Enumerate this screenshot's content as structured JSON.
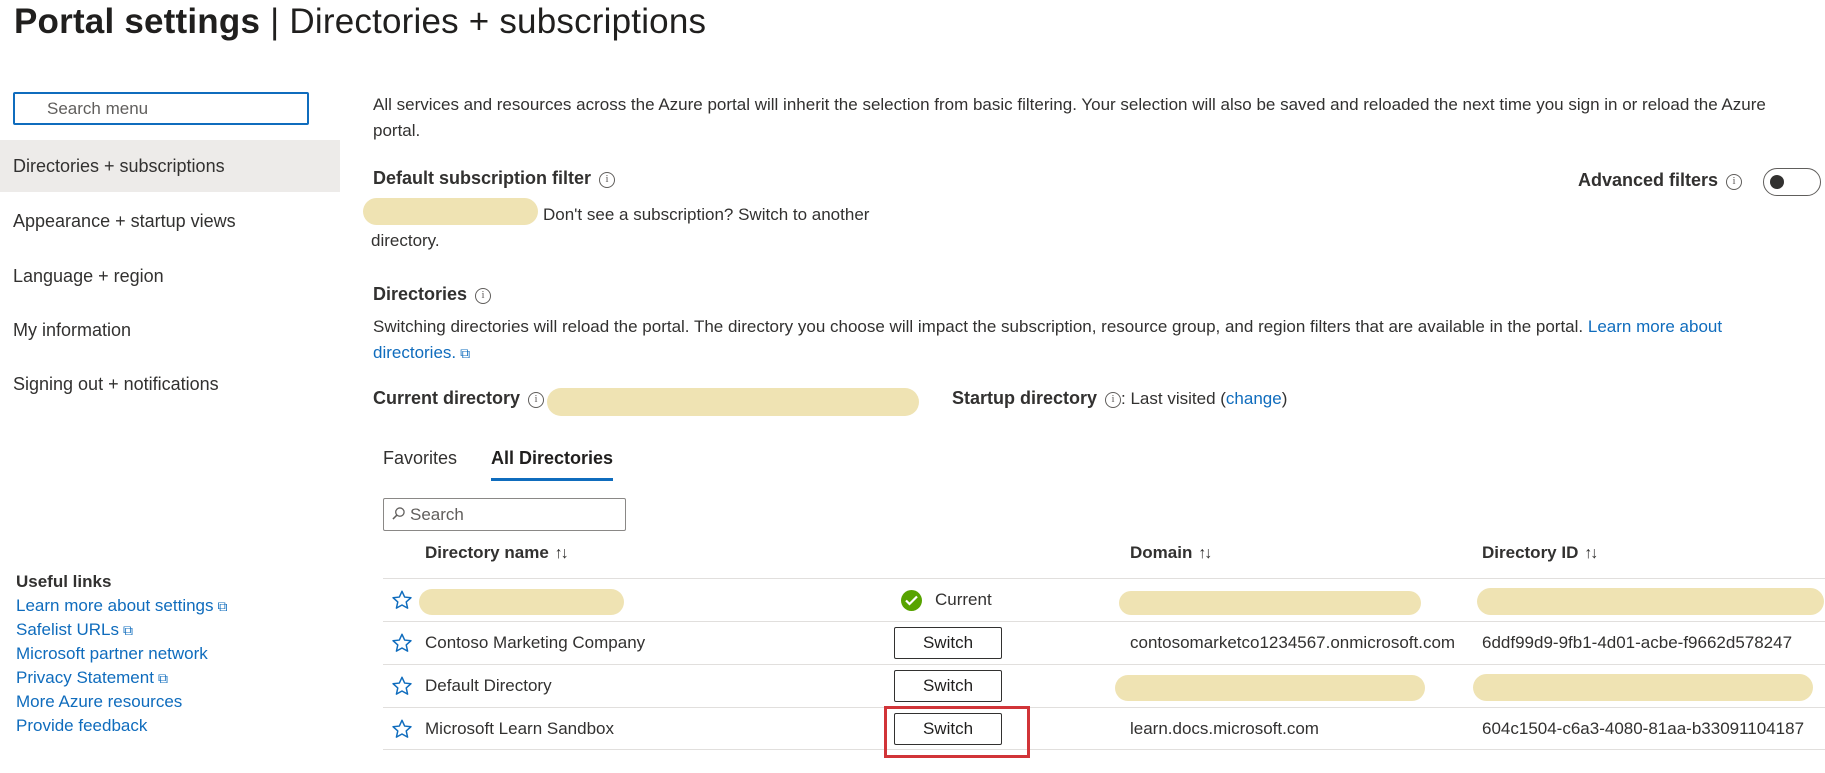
{
  "header": {
    "title_bold": "Portal settings",
    "separator": "|",
    "title_rest": "Directories + subscriptions"
  },
  "sidebar": {
    "search_placeholder": "Search menu",
    "items": [
      {
        "label": "Directories + subscriptions",
        "selected": true
      },
      {
        "label": "Appearance + startup views",
        "selected": false
      },
      {
        "label": "Language + region",
        "selected": false
      },
      {
        "label": "My information",
        "selected": false
      },
      {
        "label": "Signing out + notifications",
        "selected": false
      }
    ],
    "useful_links": {
      "heading": "Useful links",
      "links": [
        {
          "label": "Learn more about settings",
          "external": true
        },
        {
          "label": "Safelist URLs",
          "external": true
        },
        {
          "label": "Microsoft partner network",
          "external": false
        },
        {
          "label": "Privacy Statement",
          "external": true
        },
        {
          "label": "More Azure resources",
          "external": false
        },
        {
          "label": "Provide feedback",
          "external": false
        }
      ]
    }
  },
  "main": {
    "description": "All services and resources across the Azure portal will inherit the selection from basic filtering. Your selection will also be saved and reloaded the next time you sign in or reload the Azure portal.",
    "default_filter": {
      "label": "Default subscription filter",
      "note": "Don't see a subscription? Switch to another directory."
    },
    "advanced_filters": {
      "label": "Advanced filters",
      "enabled": false
    },
    "directories": {
      "label": "Directories",
      "description": "Switching directories will reload the portal. The directory you choose will impact the subscription, resource group, and region filters that are available in the portal.",
      "learn_more": "Learn more about directories.",
      "current_label": "Current directory",
      "startup_label": "Startup directory",
      "startup_value": ": Last visited (",
      "change_link": "change",
      "startup_close": ")"
    },
    "tabs": [
      {
        "label": "Favorites",
        "active": false
      },
      {
        "label": "All Directories",
        "active": true
      }
    ],
    "search_placeholder": "Search",
    "table": {
      "columns": {
        "name": "Directory name",
        "domain": "Domain",
        "id": "Directory ID"
      },
      "sort_icon": "↑↓",
      "rows": [
        {
          "name": "",
          "status": "Current",
          "domain": "",
          "id": "",
          "redacted": true
        },
        {
          "name": "Contoso Marketing Company",
          "action": "Switch",
          "domain": "contosomarketco1234567.onmicrosoft.com",
          "id": "6ddf99d9-9fb1-4d01-acbe-f9662d578247"
        },
        {
          "name": "Default Directory",
          "action": "Switch",
          "domain": "",
          "id": "",
          "redacted_partial": true
        },
        {
          "name": "Microsoft Learn Sandbox",
          "action": "Switch",
          "domain": "learn.docs.microsoft.com",
          "id": "604c1504-c6a3-4080-81aa-b33091104187",
          "highlighted": true
        }
      ]
    }
  },
  "colors": {
    "accent": "#0f6cbd",
    "selected_bg": "#edebe9",
    "highlight": "#d13438",
    "success": "#57a300",
    "redaction": "#efe3b3"
  },
  "icons": {
    "info": "info-icon",
    "external": "external-link-icon",
    "star": "star-outline-icon",
    "check": "check-circle-icon",
    "search": "search-icon"
  }
}
